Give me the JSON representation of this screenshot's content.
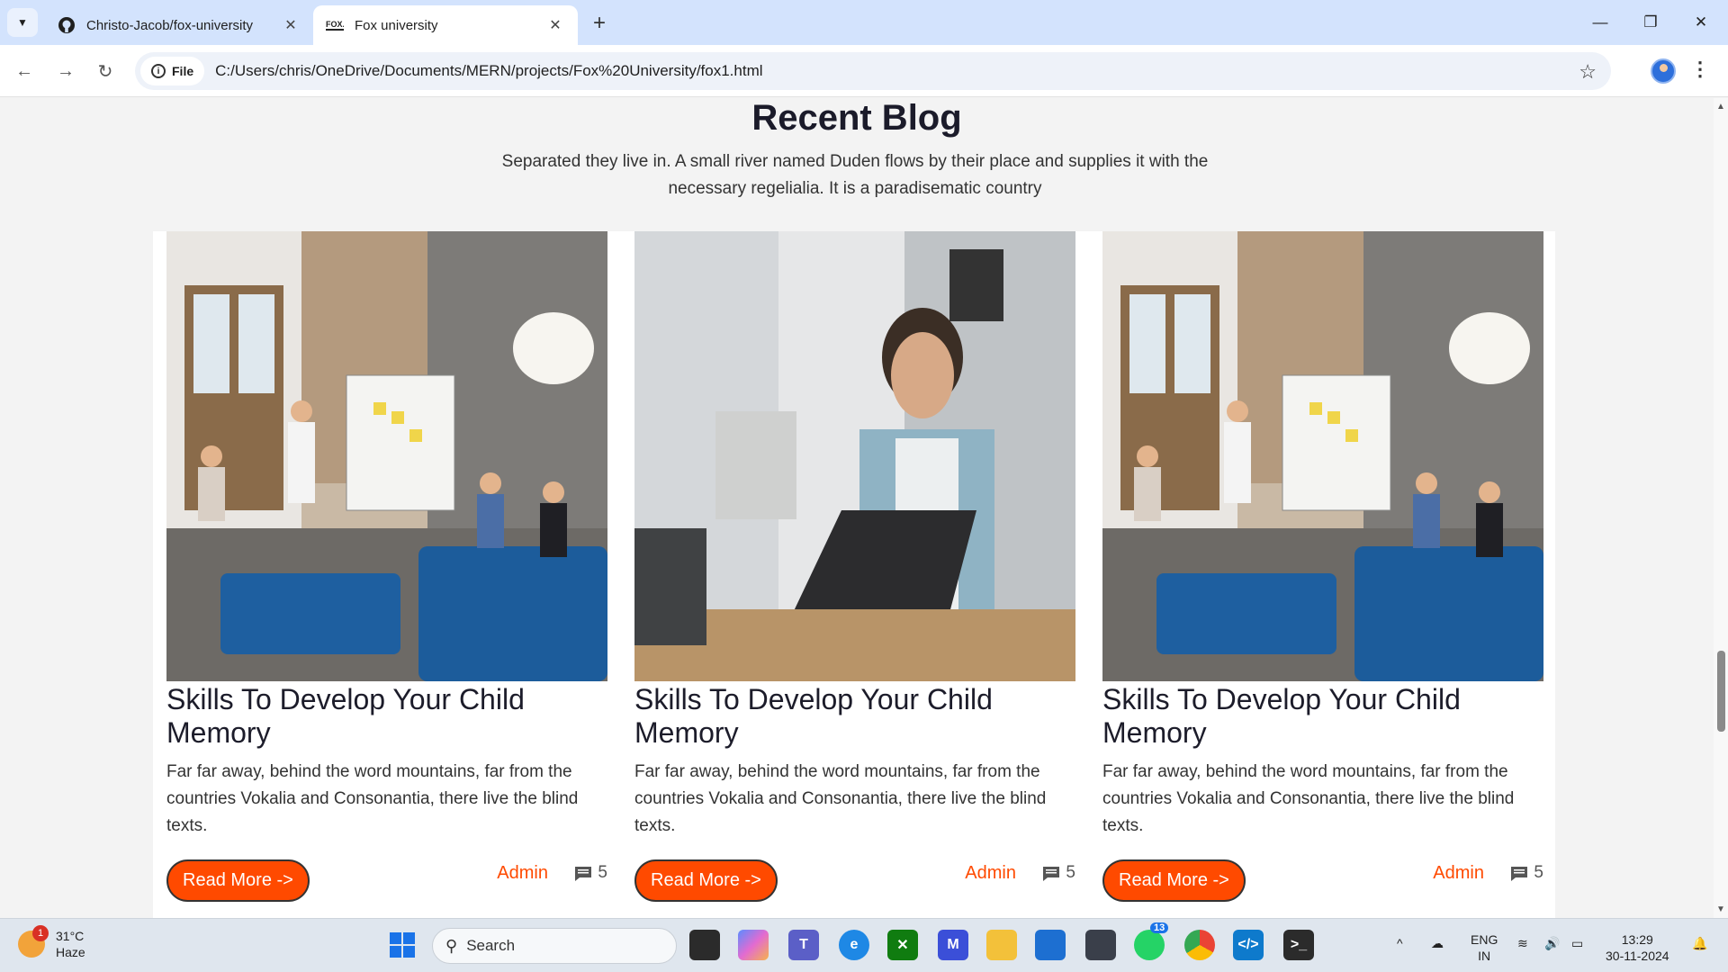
{
  "browser": {
    "tabs": [
      {
        "title": "Christo-Jacob/fox-university",
        "favicon": "github-icon",
        "active": false
      },
      {
        "title": "Fox university",
        "favicon": "fox-logo-icon",
        "active": true
      }
    ],
    "url_scheme_label": "File",
    "url": "C:/Users/chris/OneDrive/Documents/MERN/projects/Fox%20University/fox1.html"
  },
  "page": {
    "section_title": "Recent Blog",
    "section_subtitle": "Separated they live in. A small river named Duden flows by their place and supplies it with the necessary regelialia. It is a paradisematic country",
    "cards": [
      {
        "image": "team-meeting-whiteboard",
        "title": "Skills To Develop Your Child Memory",
        "excerpt": "Far far away, behind the word mountains, far from the countries Vokalia and Consonantia, there live the blind texts.",
        "button": "Read More ->",
        "author": "Admin",
        "comments": "5"
      },
      {
        "image": "man-with-headphones-laptop",
        "title": "Skills To Develop Your Child Memory",
        "excerpt": "Far far away, behind the word mountains, far from the countries Vokalia and Consonantia, there live the blind texts.",
        "button": "Read More ->",
        "author": "Admin",
        "comments": "5"
      },
      {
        "image": "team-meeting-whiteboard",
        "title": "Skills To Develop Your Child Memory",
        "excerpt": "Far far away, behind the word mountains, far from the countries Vokalia and Consonantia, there live the blind texts.",
        "button": "Read More ->",
        "author": "Admin",
        "comments": "5"
      }
    ],
    "accent_color": "#ff4a00"
  },
  "taskbar": {
    "weather_temp": "31°C",
    "weather_desc": "Haze",
    "weather_badge": "1",
    "search_placeholder": "Search",
    "whatsapp_badge": "13",
    "language": "ENG",
    "region": "IN",
    "time": "13:29",
    "date": "30-11-2024"
  }
}
